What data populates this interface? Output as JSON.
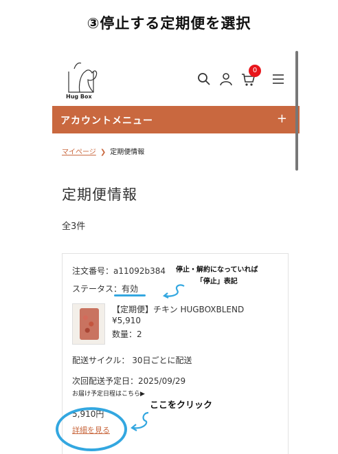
{
  "instruction": "③停止する定期便を選択",
  "header": {
    "logo_text": "Hug Box",
    "cart_count": "0",
    "icons": [
      "search-icon",
      "user-icon",
      "cart-icon",
      "hamburger-menu-icon"
    ]
  },
  "account_menu": {
    "label": "アカウントメニュー",
    "toggle": "+"
  },
  "breadcrumb": {
    "home": "マイページ",
    "separator": "❯",
    "current": "定期便情報"
  },
  "page": {
    "title": "定期便情報",
    "count": "全3件"
  },
  "subscription": {
    "order_number": "注文番号：a11092b384",
    "status": "ステータス：有効",
    "product_name": "【定期便】チキン HUGBOXBLEND",
    "price": "¥5,910",
    "quantity": "数量：2",
    "delivery_cycle": "配送サイクル： 30日ごとに配送",
    "next_delivery": "次回配送予定日：2025/09/29",
    "schedule_link": "お届け予定日程はこちら▶",
    "total_cut": "5,910円",
    "detail_link": "詳細を見る"
  },
  "annotations": {
    "status_note_line1": "停止・解約になっていれば",
    "status_note_line2": "「停止」表記",
    "click_note": "ここをクリック"
  },
  "colors": {
    "accent": "#c9683f",
    "badge": "#e8161c",
    "annotation": "#33a7e0"
  }
}
